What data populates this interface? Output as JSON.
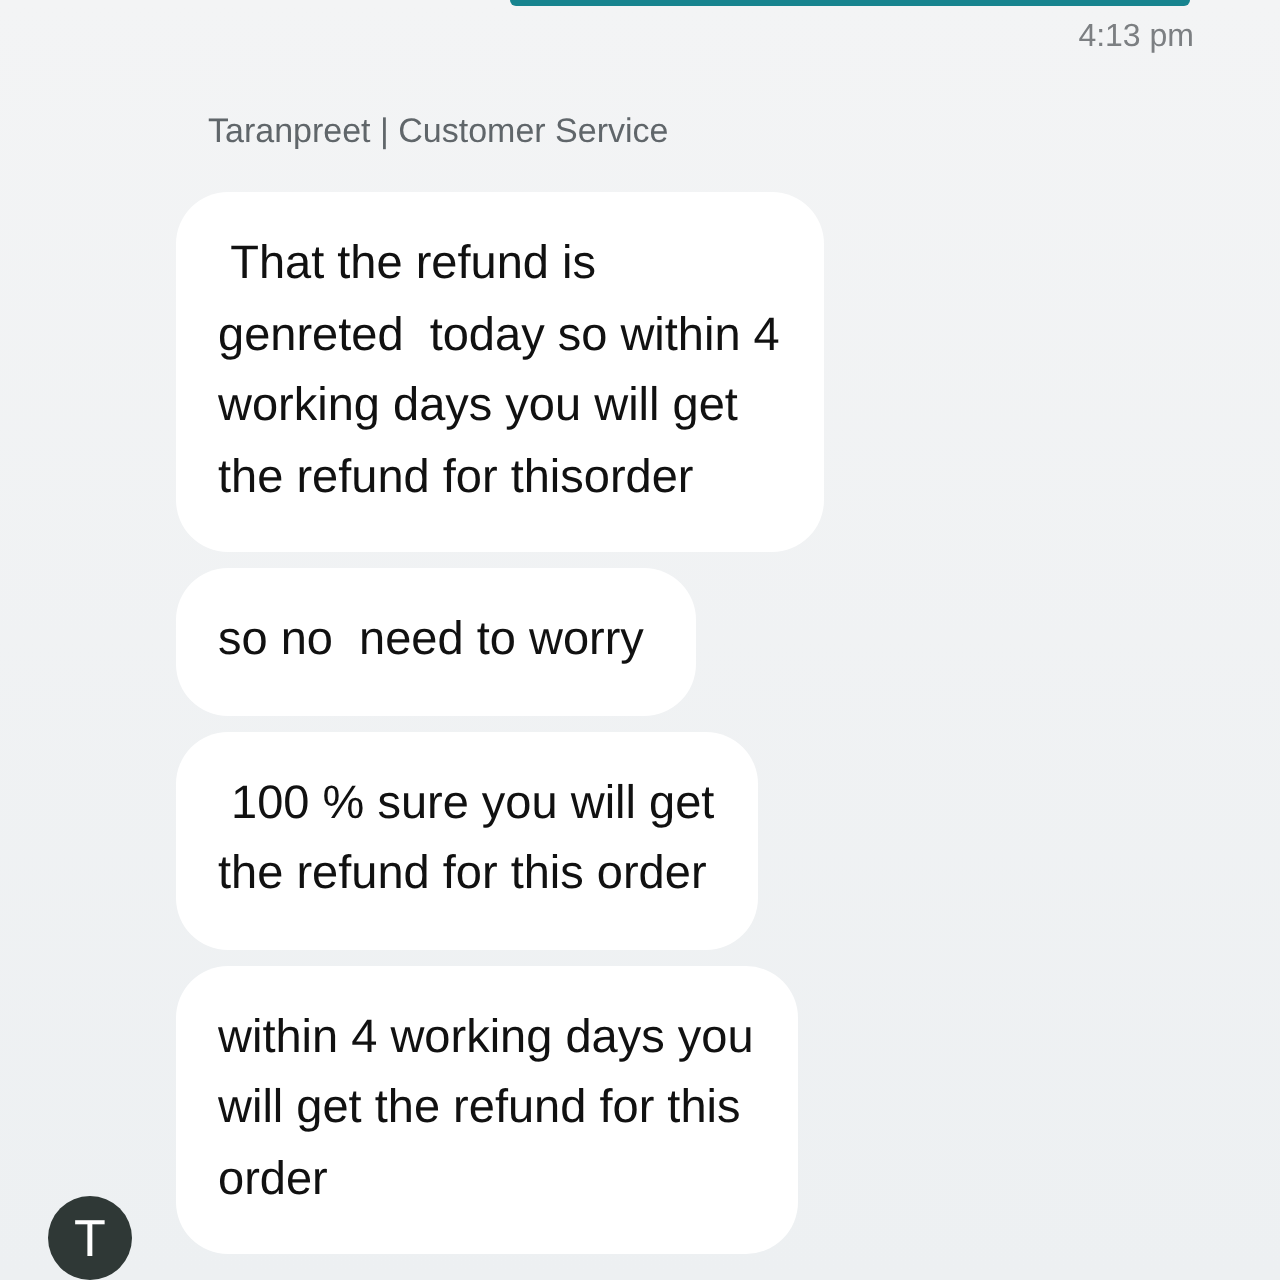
{
  "previous_message": {
    "time": "4:13 pm"
  },
  "sender": "Taranpreet | Customer Service",
  "messages": [
    {
      "lines": [
        " That the refund is",
        "genreted  today so within 4",
        "working days you will get",
        "the refund for thisorder"
      ]
    },
    {
      "lines": [
        "so no  need to worry"
      ]
    },
    {
      "lines": [
        " 100 % sure you will get",
        "the refund for this order"
      ]
    },
    {
      "lines": [
        "within 4 working days you",
        "will get the refund for this",
        "order"
      ]
    }
  ],
  "avatar": {
    "initial": "T"
  }
}
